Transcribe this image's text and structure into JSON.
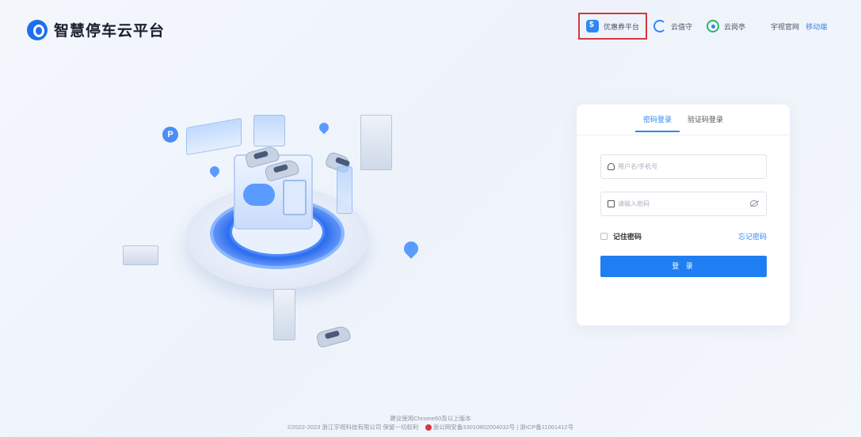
{
  "brand": {
    "title": "智慧停车云平台"
  },
  "nav": {
    "coupon": "优惠券平台",
    "cloud_guard": "云值守",
    "cloud_post": "云岗亭",
    "official_site": "宇视官网",
    "mobile": "移动端"
  },
  "login": {
    "tabs": [
      "密码登录",
      "验证码登录"
    ],
    "active_tab": "密码登录",
    "username_placeholder": "用户名/手机号",
    "password_placeholder": "请输入密码",
    "remember_label": "记住密码",
    "forgot_label": "忘记密码",
    "submit_label": "登 录"
  },
  "footer": {
    "line1": "建议使用Chrome60及以上版本",
    "copyright": "©2022-2023 浙江宇视科技有限公司 保留一切权利",
    "police_record": "浙公网安备33010802004032号 | 浙ICP备11061412号"
  },
  "colors": {
    "primary": "#1f7ef2",
    "highlight_border": "#d9363e"
  }
}
